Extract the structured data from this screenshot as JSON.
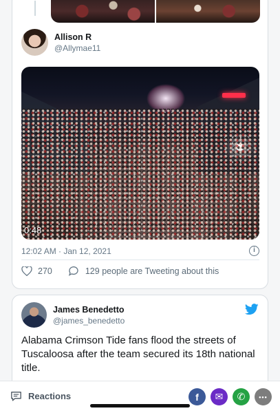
{
  "previous_tweet": {
    "author_name": "Allison R",
    "author_handle": "@Allymae11",
    "video_time": "0:48",
    "timestamp": "12:02 AM · Jan 12, 2021",
    "info_icon": "i",
    "like_count": "270",
    "conversation": "129 people are Tweeting about this"
  },
  "tweet": {
    "author_name": "James Benedetto",
    "author_handle": "@james_benedetto",
    "text": "Alabama Crimson Tide fans flood the streets of Tuscaloosa after the team secured its 18th national title."
  },
  "bottom_bar": {
    "reactions_label": "Reactions",
    "facebook_glyph": "f",
    "mail_glyph": "✉",
    "whatsapp_glyph": "✆",
    "more_glyph": "•••"
  },
  "colors": {
    "twitter_blue": "#1da1f2",
    "facebook": "#3b5998",
    "mail": "#6b2bc6",
    "whatsapp": "#25a244"
  }
}
